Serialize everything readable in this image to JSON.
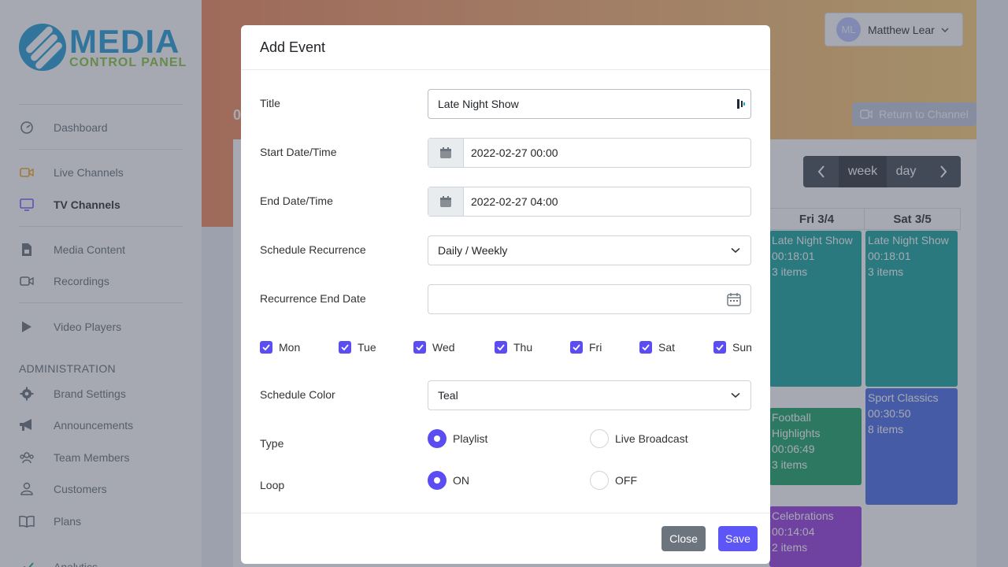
{
  "brand": {
    "name": "MEDIA",
    "subtitle": "CONTROL PANEL"
  },
  "sidebar": {
    "items": [
      {
        "label": "Dashboard",
        "icon": "gauge-icon"
      },
      {
        "label": "Live Channels",
        "icon": "video-camera-icon"
      },
      {
        "label": "TV Channels",
        "icon": "tv-icon",
        "active": true
      },
      {
        "label": "Media Content",
        "icon": "file-icon"
      },
      {
        "label": "Recordings",
        "icon": "video-camera-outline-icon"
      },
      {
        "label": "Video Players",
        "icon": "play-icon"
      }
    ],
    "admin_heading": "ADMINISTRATION",
    "admin_items": [
      {
        "label": "Brand Settings",
        "icon": "gear-icon"
      },
      {
        "label": "Announcements",
        "icon": "megaphone-icon"
      },
      {
        "label": "Team Members",
        "icon": "team-icon"
      },
      {
        "label": "Customers",
        "icon": "user-group-icon"
      },
      {
        "label": "Plans",
        "icon": "book-icon"
      },
      {
        "label": "Analytics",
        "icon": "chart-icon"
      }
    ]
  },
  "header": {
    "user": {
      "initials": "ML",
      "name": "Matthew Lear"
    },
    "return_label": "Return to Channel",
    "partial_text": "0"
  },
  "calendar": {
    "nav": {
      "week": "week",
      "day": "day"
    },
    "columns": [
      "Fri 3/4",
      "Sat 3/5"
    ],
    "events": [
      {
        "title": "Late Night Show",
        "time": "00:18:01",
        "items": "3 items",
        "color": "#19a7a0"
      },
      {
        "title": "Late Night Show",
        "time": "00:18:01",
        "items": "3 items",
        "color": "#19a7a0"
      },
      {
        "title": "Football Highlights",
        "time": "00:06:49",
        "items": "3 items",
        "color": "#20a46a"
      },
      {
        "title": "Sport Classics",
        "time": "00:30:50",
        "items": "8 items",
        "color": "#4e6fe8"
      },
      {
        "title": "Celebrations",
        "time": "00:14:04",
        "items": "2 items",
        "color": "#9a3fe0"
      }
    ]
  },
  "modal": {
    "title": "Add Event",
    "fields": {
      "title_label": "Title",
      "title_value": "Late Night Show",
      "start_label": "Start Date/Time",
      "start_value": "2022-02-27 00:00",
      "end_label": "End Date/Time",
      "end_value": "2022-02-27 04:00",
      "recurrence_label": "Schedule Recurrence",
      "recurrence_value": "Daily / Weekly",
      "recurrence_end_label": "Recurrence End Date",
      "recurrence_end_value": "",
      "color_label": "Schedule Color",
      "color_value": "Teal",
      "type_label": "Type",
      "loop_label": "Loop"
    },
    "days": [
      {
        "label": "Mon",
        "checked": true
      },
      {
        "label": "Tue",
        "checked": true
      },
      {
        "label": "Wed",
        "checked": true
      },
      {
        "label": "Thu",
        "checked": true
      },
      {
        "label": "Fri",
        "checked": true
      },
      {
        "label": "Sat",
        "checked": true
      },
      {
        "label": "Sun",
        "checked": true
      }
    ],
    "type_options": [
      {
        "label": "Playlist",
        "selected": true
      },
      {
        "label": "Live Broadcast",
        "selected": false
      }
    ],
    "loop_options": [
      {
        "label": "ON",
        "selected": true
      },
      {
        "label": "OFF",
        "selected": false
      }
    ],
    "buttons": {
      "close": "Close",
      "save": "Save"
    }
  },
  "colors": {
    "accent": "#5b4df1",
    "save": "#5d55f5",
    "close": "#6c757d"
  }
}
